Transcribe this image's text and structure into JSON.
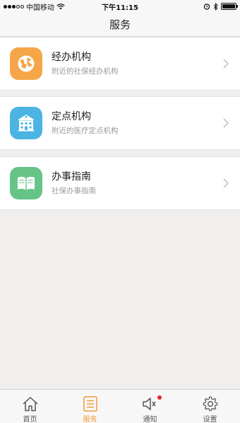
{
  "status_bar": {
    "carrier": "中国移动",
    "time": "下午11:15",
    "battery_level": 1.0
  },
  "nav": {
    "title": "服务"
  },
  "cards": [
    {
      "title": "经办机构",
      "subtitle": "附近的社保经办机构",
      "icon": "globe-icon",
      "color": "#f4a649"
    },
    {
      "title": "定点机构",
      "subtitle": "附近的医疗定点机构",
      "icon": "hospital-icon",
      "color": "#4cb4e2"
    },
    {
      "title": "办事指南",
      "subtitle": "社保办事指南",
      "icon": "book-icon",
      "color": "#66c487"
    }
  ],
  "tabs": [
    {
      "label": "首页",
      "icon": "home-icon",
      "active": false
    },
    {
      "label": "服务",
      "icon": "list-icon",
      "active": true
    },
    {
      "label": "通知",
      "icon": "speaker-icon",
      "active": false,
      "badge": true
    },
    {
      "label": "设置",
      "icon": "gear-icon",
      "active": false
    }
  ],
  "colors": {
    "accent": "#f29c38",
    "badge": "#e8242c",
    "background": "#f0efed"
  }
}
